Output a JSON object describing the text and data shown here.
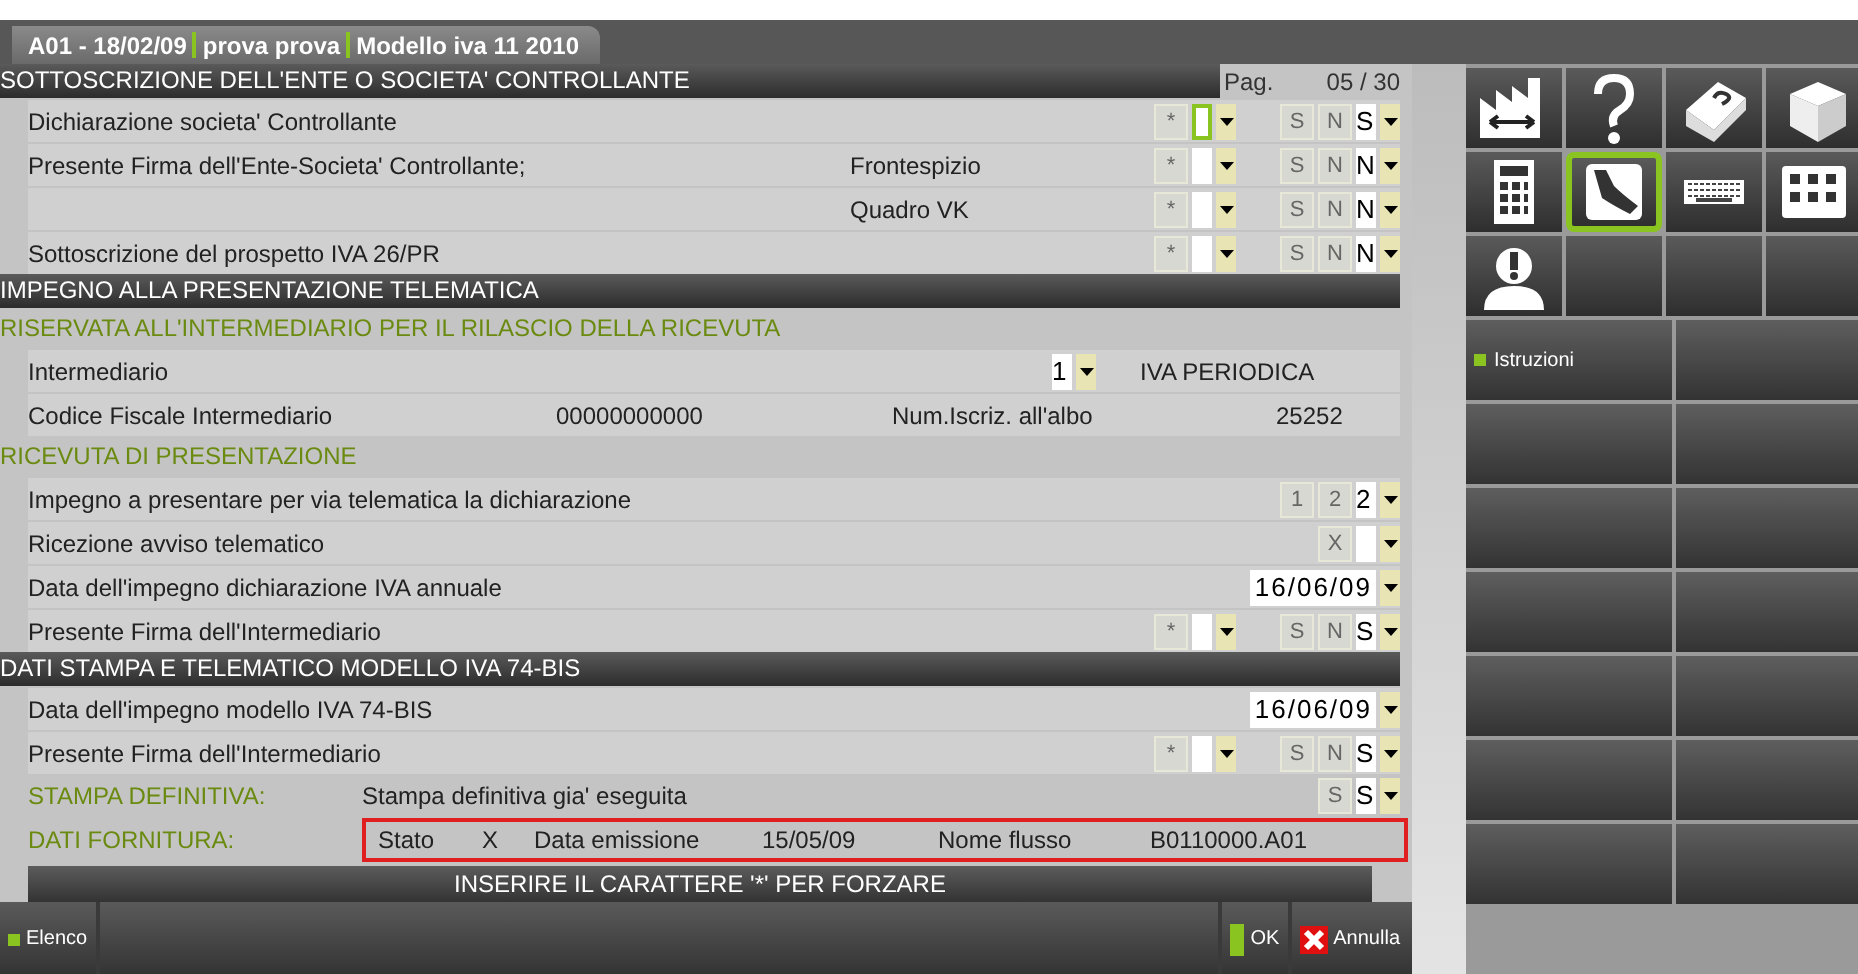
{
  "tab": {
    "parts": [
      "A01 - 18/02/09",
      "prova prova",
      "Modello iva 11 2010"
    ]
  },
  "form": {
    "blocks": [
      {
        "kind": "header",
        "title": "SOTTOSCRIZIONE DELL'ENTE O SOCIETA' CONTROLLANTE",
        "pager": {
          "label": "Pag.",
          "value": "05 / 30"
        }
      },
      {
        "kind": "row",
        "label": "Dichiarazione societa' Controllante",
        "items": [
          {
            "kind": "select",
            "options": [
              "*"
            ],
            "focused": true
          },
          {
            "kind": "select",
            "options": [
              "S",
              "N"
            ],
            "value": "S",
            "focused": false
          }
        ]
      },
      {
        "kind": "row",
        "label": "Presente Firma dell'Ente-Societa' Controllante;",
        "items": [
          {
            "kind": "text",
            "text": "Frontespizio"
          },
          {
            "kind": "select",
            "options": [
              "*"
            ],
            "focused": false
          },
          {
            "kind": "select",
            "options": [
              "S",
              "N"
            ],
            "value": "N",
            "focused": false
          }
        ]
      },
      {
        "kind": "row",
        "items": [
          {
            "kind": "text",
            "text": "Quadro VK"
          },
          {
            "kind": "select",
            "options": [
              "*"
            ],
            "focused": false
          },
          {
            "kind": "select",
            "options": [
              "S",
              "N"
            ],
            "value": "N",
            "focused": false
          }
        ]
      },
      {
        "kind": "row",
        "label": "Sottoscrizione del prospetto IVA 26/PR",
        "items": [
          {
            "kind": "select",
            "options": [
              "*"
            ],
            "focused": false
          },
          {
            "kind": "select",
            "options": [
              "S",
              "N"
            ],
            "value": "N",
            "focused": false
          }
        ]
      },
      {
        "kind": "header",
        "title": "IMPEGNO ALLA PRESENTAZIONE TELEMATICA"
      },
      {
        "kind": "subheader",
        "title": "RISERVATA ALL'INTERMEDIARIO PER IL RILASCIO DELLA RICEVUTA"
      },
      {
        "kind": "row",
        "label": "Intermediario",
        "items": [
          {
            "kind": "select",
            "value": "1",
            "focused": false
          },
          {
            "kind": "text",
            "text": "IVA PERIODICA"
          }
        ]
      },
      {
        "kind": "pair",
        "label": "Codice Fiscale Intermediario",
        "items": [
          {
            "kind": "text",
            "text": "00000000000"
          },
          {
            "kind": "text",
            "text": "Num.Iscriz. all'albo"
          },
          {
            "kind": "text",
            "text": "25252"
          }
        ]
      },
      {
        "kind": "subheader",
        "title": "RICEVUTA DI PRESENTAZIONE"
      },
      {
        "kind": "row",
        "label": "Impegno a presentare per via telematica la dichiarazione",
        "items": [
          {
            "kind": "select",
            "options": [
              "1",
              "2"
            ],
            "value": "2",
            "focused": false
          }
        ]
      },
      {
        "kind": "row",
        "label": "Ricezione avviso telematico",
        "items": [
          {
            "kind": "select",
            "options": [
              "X"
            ],
            "focused": false
          }
        ]
      },
      {
        "kind": "row",
        "label": "Data dell'impegno dichiarazione IVA annuale",
        "items": [
          {
            "kind": "select",
            "value": "16/06/09",
            "focused": false
          }
        ]
      },
      {
        "kind": "row",
        "label": "Presente Firma dell'Intermediario",
        "items": [
          {
            "kind": "select",
            "options": [
              "*"
            ],
            "focused": false
          },
          {
            "kind": "select",
            "options": [
              "S",
              "N"
            ],
            "value": "S",
            "focused": false
          }
        ]
      },
      {
        "kind": "header",
        "title": "DATI STAMPA E TELEMATICO MODELLO IVA 74-BIS"
      },
      {
        "kind": "row",
        "label": "Data dell'impegno modello IVA 74-BIS",
        "items": [
          {
            "kind": "select",
            "value": "16/06/09",
            "focused": false
          }
        ]
      },
      {
        "kind": "row",
        "label": "Presente Firma dell'Intermediario",
        "items": [
          {
            "kind": "select",
            "options": [
              "*"
            ],
            "focused": false
          },
          {
            "kind": "select",
            "options": [
              "S",
              "N"
            ],
            "value": "S",
            "focused": false
          }
        ]
      },
      {
        "kind": "note",
        "label": "STAMPA DEFINITIVA:",
        "items": [
          {
            "kind": "text",
            "text": "Stampa definitiva gia' eseguita"
          },
          {
            "kind": "select",
            "options": [
              "S"
            ],
            "value": "S",
            "focused": false
          }
        ]
      },
      {
        "kind": "note",
        "label": "DATI FORNITURA:",
        "items": [
          {
            "kind": "framed",
            "fields": [
              {
                "label": "Stato",
                "value": "X"
              },
              {
                "label": "Data emissione",
                "value": "15/05/09"
              },
              {
                "label": "Nome flusso",
                "value": "B0110000.A01"
              }
            ]
          }
        ]
      }
    ],
    "message": "INSERIRE IL CARATTERE '*' PER FORZARE"
  },
  "bottom_bar": [
    {
      "kind": "elenco",
      "label": "Elenco"
    },
    {
      "kind": "ok",
      "label": "OK"
    },
    {
      "kind": "cancel",
      "label": "Annulla"
    }
  ],
  "tools": [
    {
      "selected": false
    },
    {
      "selected": false
    },
    {
      "selected": false
    },
    {
      "selected": false
    },
    {
      "selected": false
    },
    {
      "selected": true
    },
    {
      "selected": false
    },
    {
      "selected": false
    },
    {
      "selected": false
    }
  ],
  "side_buttons": [
    {
      "label": "Istruzioni"
    }
  ]
}
